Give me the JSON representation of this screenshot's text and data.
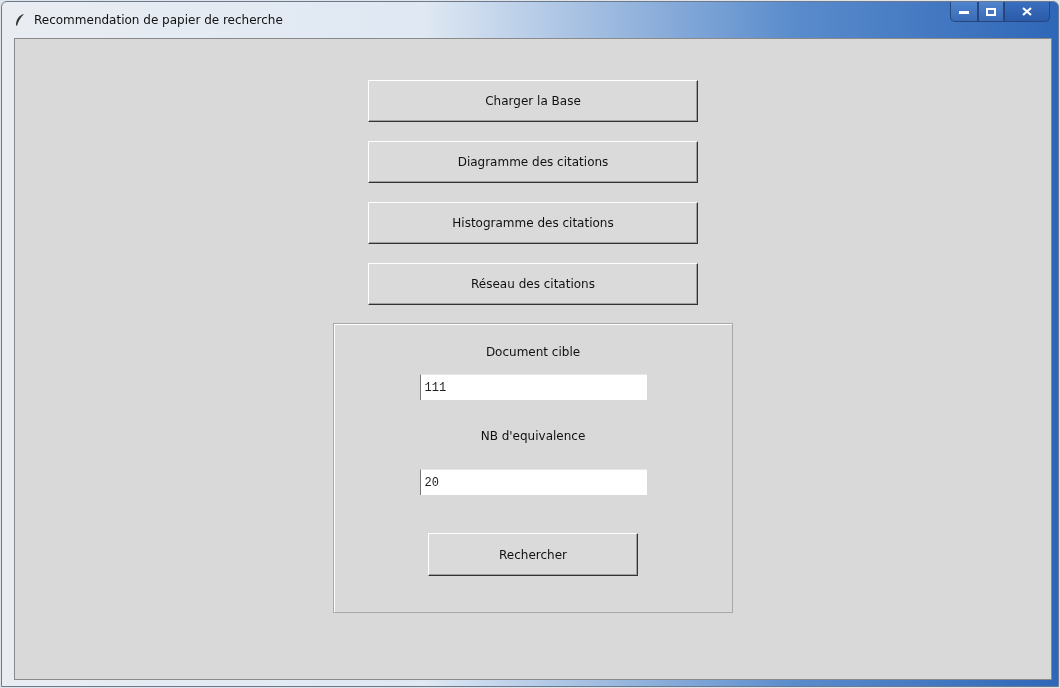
{
  "window": {
    "title": "Recommendation de papier de recherche"
  },
  "buttons": [
    {
      "label": "Charger la Base"
    },
    {
      "label": "Diagramme des citations"
    },
    {
      "label": "Histogramme des citations"
    },
    {
      "label": "Réseau des citations"
    }
  ],
  "search_panel": {
    "fields": [
      {
        "label": "Document cible",
        "value": "111"
      },
      {
        "label": "NB d'equivalence",
        "value": "20"
      }
    ],
    "button": "Rechercher"
  }
}
